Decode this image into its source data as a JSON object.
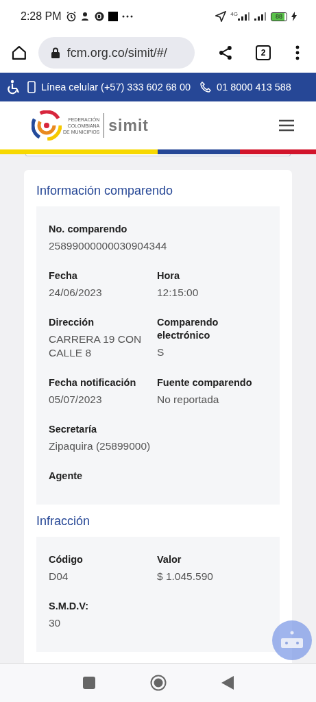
{
  "status_bar": {
    "time": "2:28 PM",
    "network": "4G",
    "battery": "88"
  },
  "browser": {
    "url": "fcm.org.co/simit/#/",
    "tab_count": "2"
  },
  "contact_bar": {
    "mobile_line": "Línea celular (+57) 333 602 68 00",
    "phone": "01 8000 413 588"
  },
  "header": {
    "logo_lines": [
      "FEDERACIÓN",
      "COLOMBIANA",
      "DE MUNICIPIOS"
    ],
    "brand": "simit"
  },
  "sections": [
    {
      "title": "Información comparendo",
      "rows": [
        [
          {
            "label": "No. comparendo",
            "value": "25899000000030904344"
          }
        ],
        [
          {
            "label": "Fecha",
            "value": "24/06/2023"
          },
          {
            "label": "Hora",
            "value": "12:15:00"
          }
        ],
        [
          {
            "label": "Dirección",
            "value": "CARRERA 19 CON CALLE 8"
          },
          {
            "label": "Comparendo electrónico",
            "value": "S"
          }
        ],
        [
          {
            "label": "Fecha notificación",
            "value": "05/07/2023"
          },
          {
            "label": "Fuente comparendo",
            "value": "No reportada"
          }
        ],
        [
          {
            "label": "Secretaría",
            "value": "Zipaquira (25899000)"
          }
        ],
        [
          {
            "label": "Agente"
          }
        ]
      ]
    },
    {
      "title": "Infracción",
      "rows": [
        [
          {
            "label": "Código",
            "value": "D04"
          },
          {
            "label": "Valor",
            "value": "$ 1.045.590"
          }
        ],
        [
          {
            "label": "S.M.D.V:",
            "value": "30"
          }
        ]
      ]
    }
  ]
}
